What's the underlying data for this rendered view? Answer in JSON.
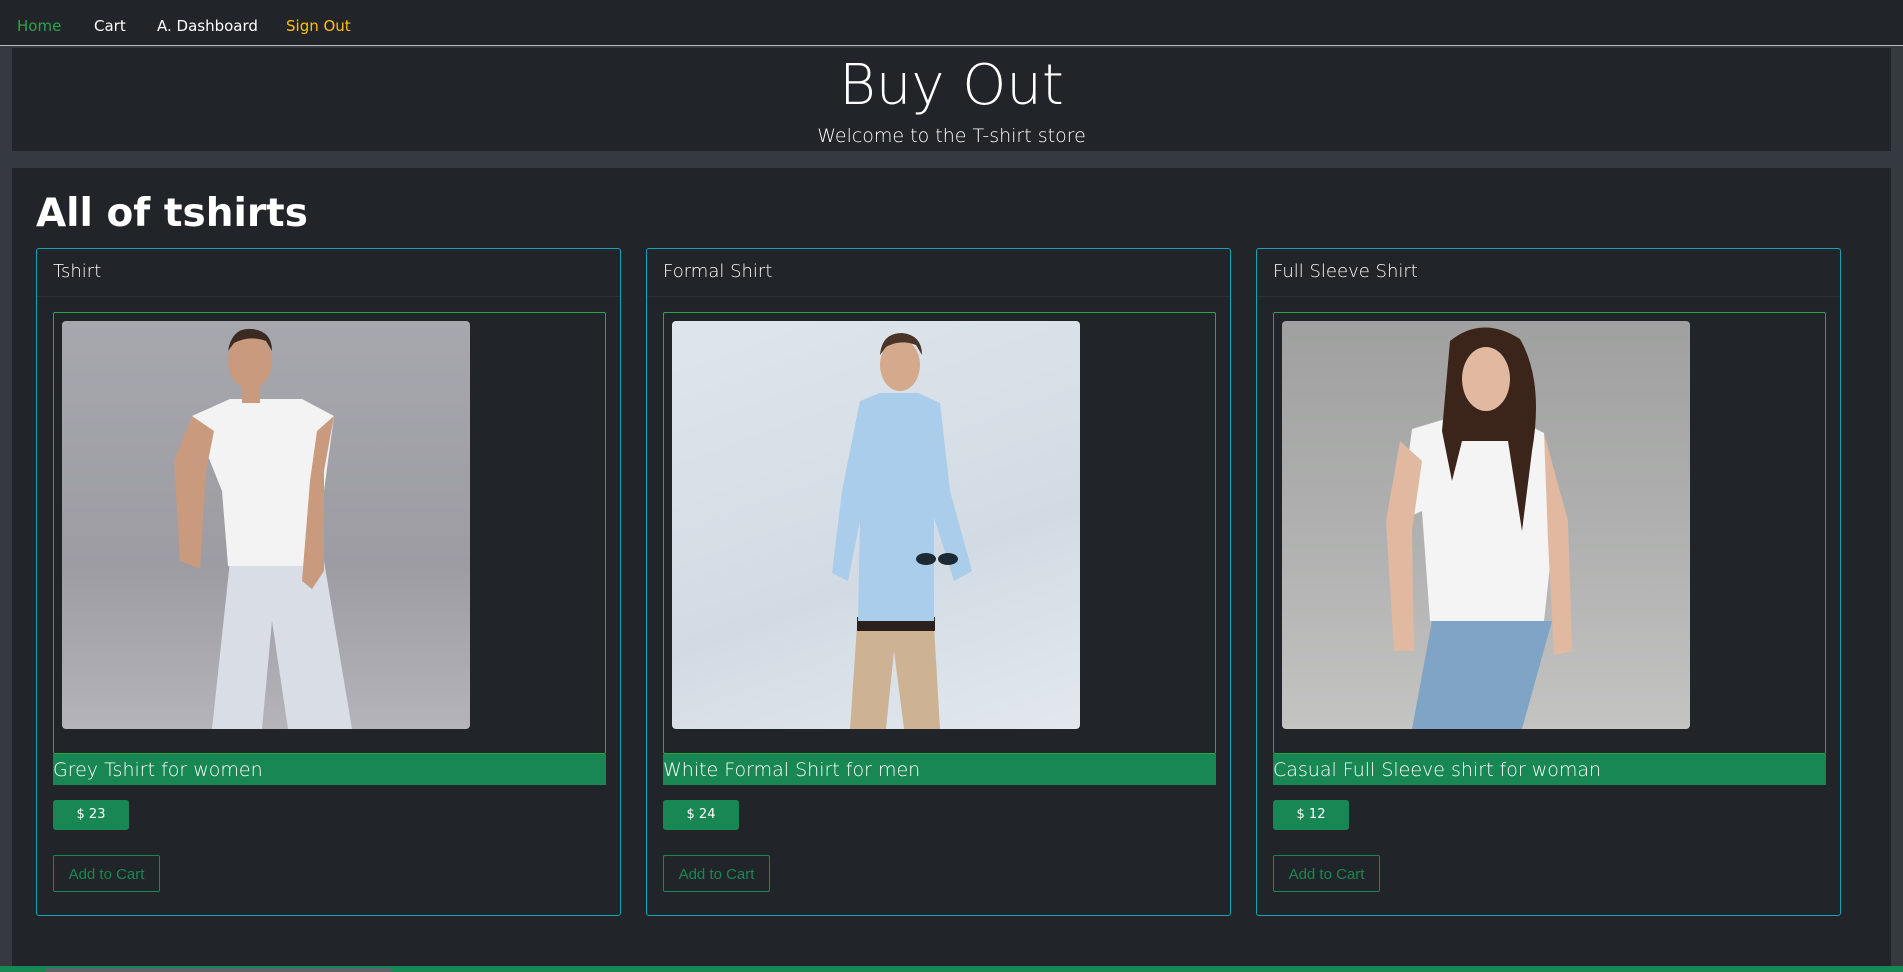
{
  "nav": {
    "home": "Home",
    "cart": "Cart",
    "dashboard": "A. Dashboard",
    "signout": "Sign Out"
  },
  "hero": {
    "title": "Buy Out",
    "subtitle": "Welcome to the T-shirt store"
  },
  "main": {
    "heading": "All of tshirts",
    "products": [
      {
        "name": "Tshirt",
        "description": "Grey Tshirt for women",
        "price": "$ 23",
        "button": "Add to Cart",
        "image": "man-white-tshirt-photo"
      },
      {
        "name": "Formal Shirt",
        "description": "White Formal Shirt for men",
        "price": "$ 24",
        "button": "Add to Cart",
        "image": "man-blue-formal-shirt-photo"
      },
      {
        "name": "Full Sleeve Shirt",
        "description": "Casual Full Sleeve shirt for woman",
        "price": "$ 12",
        "button": "Add to Cart",
        "image": "woman-white-tshirt-photo"
      }
    ]
  },
  "colors": {
    "background": "#343a40",
    "panel": "#212529",
    "success": "#198754",
    "info": "#17a2b8",
    "warning": "#ffc107",
    "nav_active": "#28a745"
  }
}
